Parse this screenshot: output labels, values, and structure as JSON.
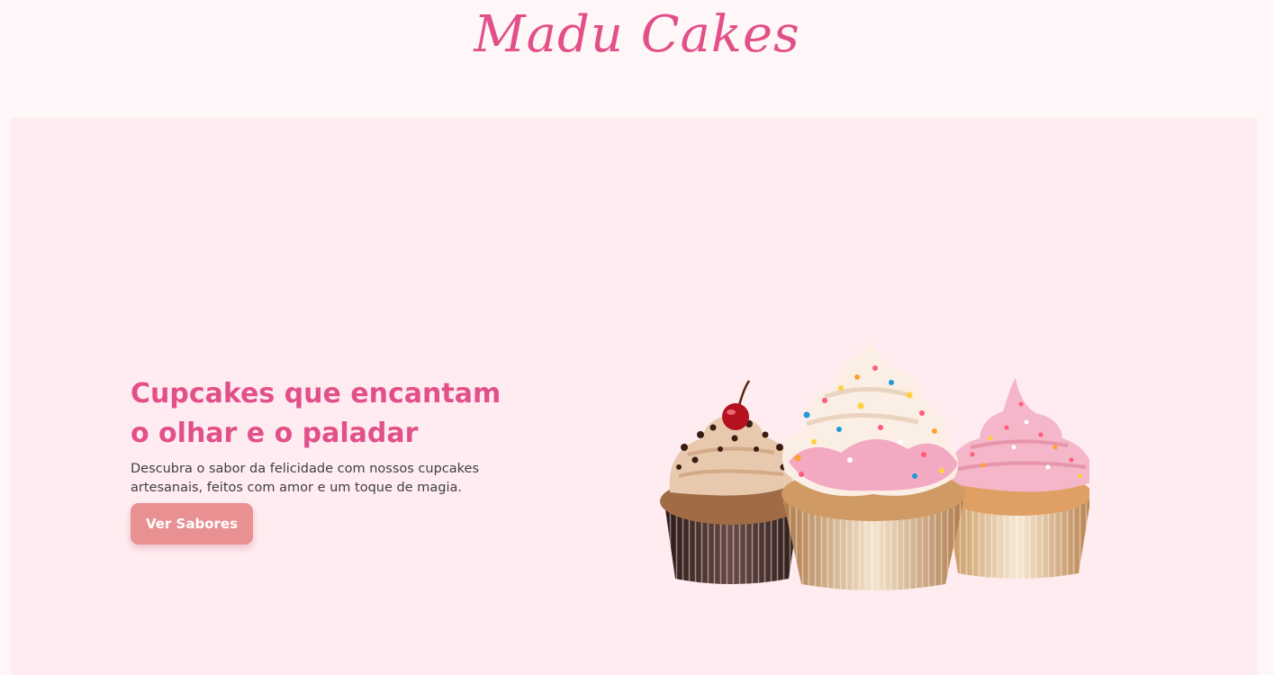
{
  "header": {
    "logo_text": "Madu Cakes"
  },
  "hero": {
    "title": "Cupcakes que encantam o olhar e o paladar",
    "description": "Descubra o sabor da felicidade com nossos cupcakes artesanais, feitos com amor e um toque de magia.",
    "cta_label": "Ver Sabores",
    "image_icon": "cupcakes-illustration"
  },
  "colors": {
    "page_background": "#fff7f7",
    "hero_background": "#ffecf1",
    "brand_pink": "#e2508a",
    "button_background": "#e89092",
    "body_text": "#3f3f3f"
  }
}
